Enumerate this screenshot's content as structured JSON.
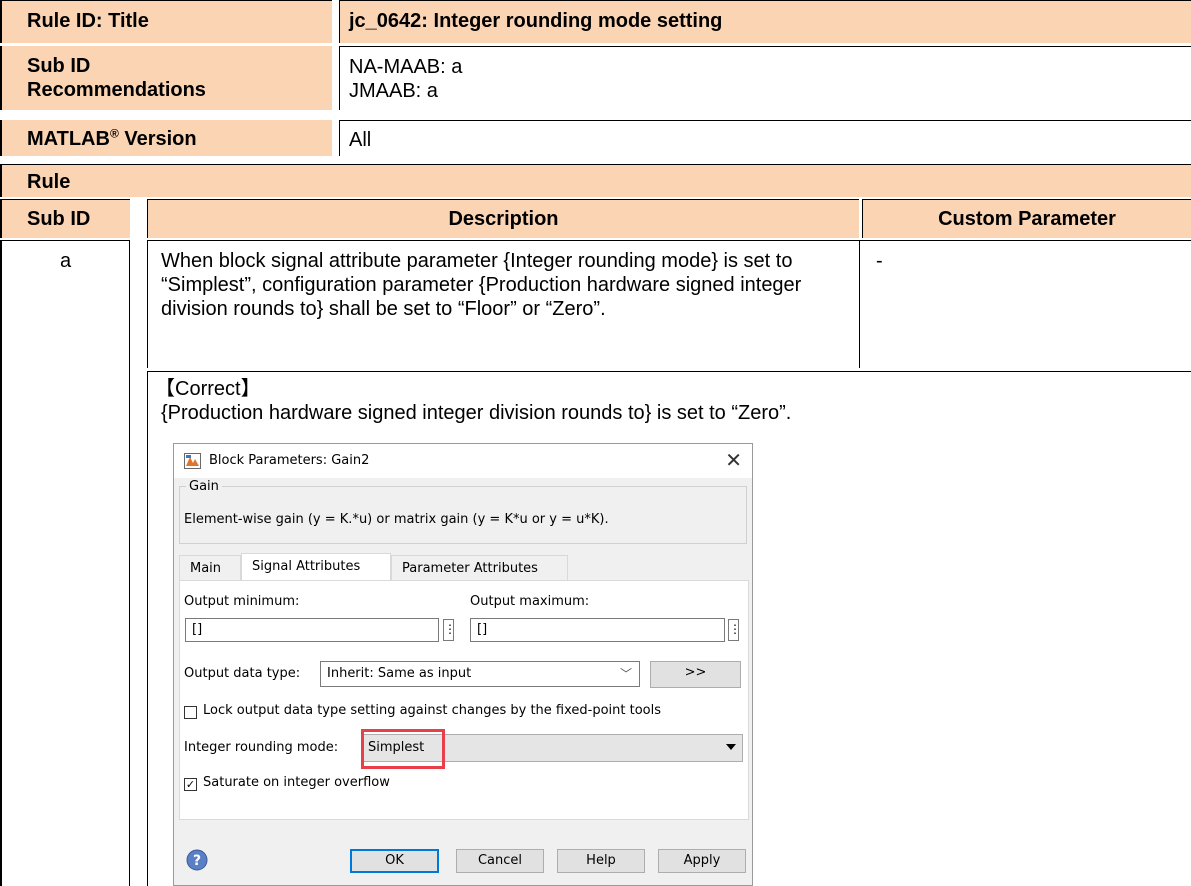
{
  "rule_table": {
    "rule_id_label": "Rule ID: Title",
    "rule_id_value": "jc_0642: Integer rounding mode setting",
    "sub_id_label": "Sub ID\nRecommendations",
    "sub_id_value_1": "NA-MAAB: a",
    "sub_id_value_2": "JMAAB: a",
    "matlab_label": "MATLAB",
    "matlab_sup": "®",
    "matlab_label_suffix": " Version",
    "matlab_value": "All",
    "rule_header": "Rule",
    "col_sub_id": "Sub ID",
    "col_description": "Description",
    "col_custom_param": "Custom Parameter",
    "row_sub_id": "a",
    "row_description": "When block signal attribute parameter {Integer rounding mode} is set to “Simplest”, configuration parameter {Production hardware signed integer division rounds to} shall be set to “Floor” or “Zero”.",
    "row_custom_param": "-",
    "correct_label": "【Correct】",
    "correct_text": "{Production hardware signed integer division rounds to} is set to “Zero”."
  },
  "dialog": {
    "title": "Block Parameters: Gain2",
    "close_glyph": "✕",
    "section_label": "Gain",
    "description": "Element-wise gain (y = K.*u) or matrix gain (y = K*u or y = u*K).",
    "tabs": [
      "Main",
      "Signal Attributes",
      "Parameter Attributes"
    ],
    "active_tab": "Signal Attributes",
    "output_min_label": "Output minimum:",
    "output_min_value": "[]",
    "output_max_label": "Output maximum:",
    "output_max_value": "[]",
    "data_type_label": "Output data type:",
    "data_type_value": "Inherit: Same as input",
    "data_type_assistant_button": ">>",
    "lock_checkbox_label": "Lock output data type setting against changes by the fixed-point tools",
    "lock_checked": false,
    "rounding_label": "Integer rounding mode:",
    "rounding_value": "Simplest",
    "saturate_checkbox_label": "Saturate on integer overflow",
    "saturate_checked": true,
    "buttons": {
      "ok": "OK",
      "cancel": "Cancel",
      "help": "Help",
      "apply": "Apply"
    },
    "highlight_color": "#e8404a"
  },
  "colors": {
    "header_fill": "#fbd4b4"
  }
}
